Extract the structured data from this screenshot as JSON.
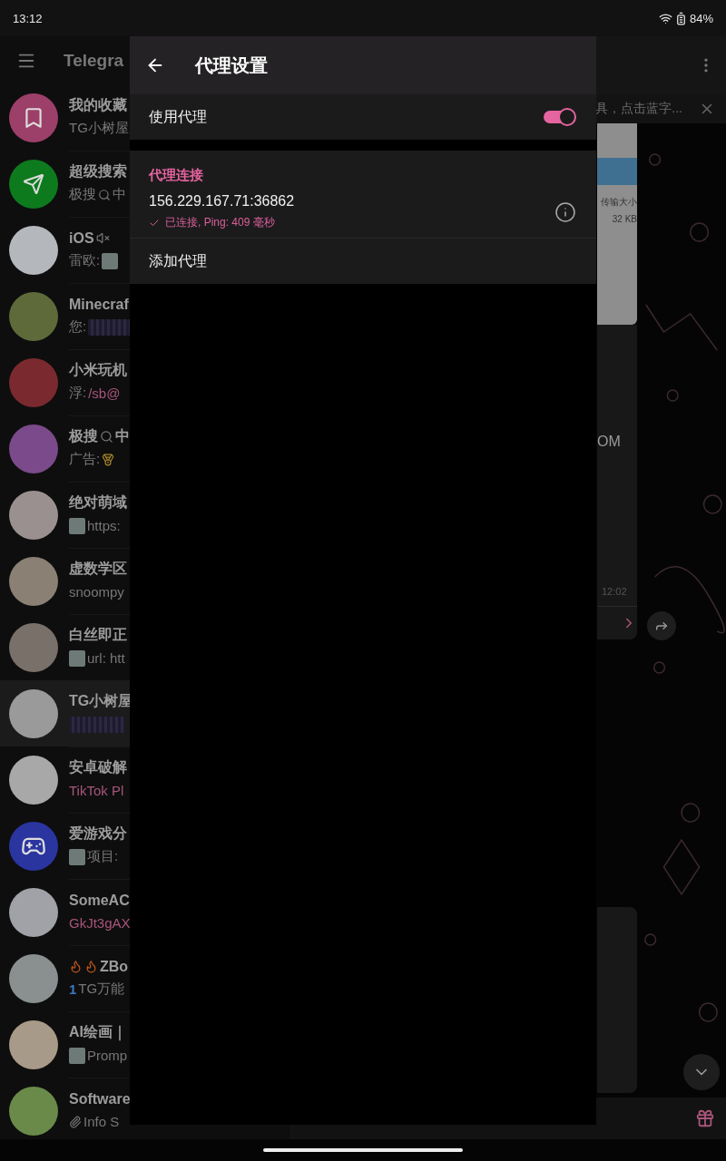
{
  "status_bar": {
    "time": "13:12",
    "battery": "84%"
  },
  "chat_list": {
    "title": "Telegra",
    "chats": [
      {
        "avatar": {
          "kind": "bookmark",
          "color": "#9c3f69"
        },
        "selected": false,
        "name": [
          {
            "kind": "text",
            "text": "我的收藏"
          }
        ],
        "preview": [
          {
            "kind": "text",
            "text": "TG小树屋"
          }
        ]
      },
      {
        "avatar": {
          "kind": "plane",
          "color": "#0d7a1e"
        },
        "selected": false,
        "name": [
          {
            "kind": "text",
            "text": "超级搜索"
          }
        ],
        "preview": [
          {
            "kind": "text",
            "text": "极搜"
          },
          {
            "kind": "magnifier"
          },
          {
            "kind": "text",
            "text": "中"
          }
        ]
      },
      {
        "avatar": {
          "kind": "photo",
          "color": "#b4b8bc"
        },
        "selected": false,
        "name": [
          {
            "kind": "text",
            "text": "iOS"
          },
          {
            "kind": "mute"
          }
        ],
        "preview": [
          {
            "kind": "text",
            "text": "雷欧:"
          },
          {
            "kind": "thumb"
          }
        ]
      },
      {
        "avatar": {
          "kind": "photo",
          "color": "#5f6a3a"
        },
        "selected": false,
        "name": [
          {
            "kind": "text",
            "text": "Minecraf"
          }
        ],
        "preview": [
          {
            "kind": "text",
            "text": "您:"
          },
          {
            "kind": "blur"
          }
        ]
      },
      {
        "avatar": {
          "kind": "photo",
          "color": "#7a2a2e"
        },
        "selected": false,
        "name": [
          {
            "kind": "text",
            "text": "小米玩机"
          }
        ],
        "preview": [
          {
            "kind": "text",
            "text": "浮:"
          },
          {
            "kind": "link",
            "text": "/sb@"
          }
        ]
      },
      {
        "avatar": {
          "kind": "photo",
          "color": "#7a4a8a"
        },
        "selected": false,
        "name": [
          {
            "kind": "text",
            "text": "极搜"
          },
          {
            "kind": "magnifier"
          },
          {
            "kind": "text",
            "text": "中"
          }
        ],
        "preview": [
          {
            "kind": "text",
            "text": "广告:"
          },
          {
            "kind": "medal"
          }
        ]
      },
      {
        "avatar": {
          "kind": "photo",
          "color": "#9a9090"
        },
        "selected": false,
        "name": [
          {
            "kind": "text",
            "text": "绝对萌域"
          }
        ],
        "preview": [
          {
            "kind": "thumb"
          },
          {
            "kind": "text",
            "text": "https:"
          }
        ]
      },
      {
        "avatar": {
          "kind": "photo",
          "color": "#8a8074"
        },
        "selected": false,
        "name": [
          {
            "kind": "text",
            "text": "虚数学区"
          }
        ],
        "preview": [
          {
            "kind": "text",
            "text": "snoompy"
          }
        ]
      },
      {
        "avatar": {
          "kind": "photo",
          "color": "#7a706a"
        },
        "selected": false,
        "name": [
          {
            "kind": "text",
            "text": "白丝即正"
          }
        ],
        "preview": [
          {
            "kind": "thumb"
          },
          {
            "kind": "text",
            "text": "url: htt"
          }
        ]
      },
      {
        "avatar": {
          "kind": "photo",
          "color": "#9a9a9a"
        },
        "selected": true,
        "name": [
          {
            "kind": "text",
            "text": "TG小树屋"
          }
        ],
        "preview": [
          {
            "kind": "blur"
          }
        ]
      },
      {
        "avatar": {
          "kind": "photo",
          "color": "#a8a8a8"
        },
        "selected": false,
        "name": [
          {
            "kind": "text",
            "text": "安卓破解"
          }
        ],
        "preview": [
          {
            "kind": "link",
            "text": "TikTok Pl"
          }
        ]
      },
      {
        "avatar": {
          "kind": "gamepad",
          "color": "#2a35a0"
        },
        "selected": false,
        "name": [
          {
            "kind": "text",
            "text": "爱游戏分"
          }
        ],
        "preview": [
          {
            "kind": "thumb"
          },
          {
            "kind": "text",
            "text": "项目:"
          }
        ]
      },
      {
        "avatar": {
          "kind": "photo",
          "color": "#a0a2a8"
        },
        "selected": false,
        "name": [
          {
            "kind": "text",
            "text": "SomeAC"
          }
        ],
        "preview": [
          {
            "kind": "link",
            "text": "GkJt3gAX"
          }
        ]
      },
      {
        "avatar": {
          "kind": "photo",
          "color": "#8a8f90"
        },
        "selected": false,
        "name": [
          {
            "kind": "flame"
          },
          {
            "kind": "flame"
          },
          {
            "kind": "text",
            "text": "ZBo"
          }
        ],
        "preview": [
          {
            "kind": "accent",
            "text": "1"
          },
          {
            "kind": "text",
            "text": "TG万能"
          }
        ]
      },
      {
        "avatar": {
          "kind": "photo",
          "color": "#a89a88"
        },
        "selected": false,
        "name": [
          {
            "kind": "text",
            "text": "AI绘画｜"
          }
        ],
        "preview": [
          {
            "kind": "thumb"
          },
          {
            "kind": "text",
            "text": "Promp"
          }
        ]
      },
      {
        "avatar": {
          "kind": "photo",
          "color": "#6a8a4a"
        },
        "selected": false,
        "name": [
          {
            "kind": "text",
            "text": "Software"
          }
        ],
        "preview": [
          {
            "kind": "paperclip"
          },
          {
            "kind": "text",
            "text": "Info S"
          }
        ]
      }
    ]
  },
  "chat": {
    "pinned_text": "具，点击蓝字...",
    "image_texts": [
      "传输大小",
      "32 KB"
    ],
    "message_text": "OM",
    "message_time": "12:02"
  },
  "proxy_settings": {
    "title": "代理设置",
    "use_proxy": {
      "label": "使用代理",
      "on": true
    },
    "section_title": "代理连接",
    "proxies": [
      {
        "address": "156.229.167.71:36862",
        "status": "已连接, Ping: 409 毫秒",
        "connected": true
      }
    ],
    "add_label": "添加代理"
  }
}
